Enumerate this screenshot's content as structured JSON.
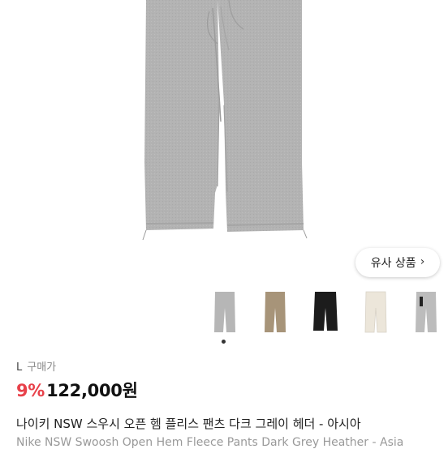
{
  "similar_button": {
    "label": "유사 상품",
    "icon": "chevron-right-icon"
  },
  "thumbnails": [
    {
      "color": "#b6b6b6",
      "name": "grey"
    },
    {
      "color": "#a79479",
      "name": "khaki"
    },
    {
      "color": "#1c1c1c",
      "name": "black"
    },
    {
      "color": "#ece6da",
      "name": "cream"
    },
    {
      "color": "#bcbcbc",
      "name": "grey-heather"
    }
  ],
  "thumbnails_selected_index": 0,
  "purchase_info": {
    "size": "L",
    "label": "구매가"
  },
  "price": {
    "discount": "9%",
    "amount": "122,000원",
    "discount_color": "#e8414a"
  },
  "product": {
    "title_ko": "나이키 NSW 스우시 오픈 헴 플리스 팬츠 다크 그레이 헤더 - 아시아",
    "title_en": "Nike NSW Swoosh Open Hem Fleece Pants Dark Grey Heather - Asia"
  },
  "hero": {
    "fabric_color": "#b4b4b4"
  }
}
